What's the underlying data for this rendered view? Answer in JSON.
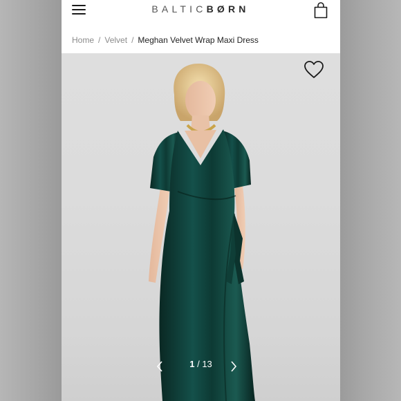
{
  "brand": {
    "name_light": "BALTIC",
    "name_bold": "BØRN"
  },
  "breadcrumb": {
    "items": [
      "Home",
      "Velvet"
    ],
    "separator": "/",
    "current": "Meghan Velvet Wrap Maxi Dress"
  },
  "gallery": {
    "current": "1",
    "separator": "/",
    "total": "13"
  },
  "icons": {
    "menu": "hamburger-menu-icon",
    "cart": "shopping-bag-icon",
    "wishlist": "heart-icon",
    "prev": "chevron-left-icon",
    "next": "chevron-right-icon"
  },
  "colors": {
    "dress": "#0f3a33",
    "background": "#dcdcdc",
    "text_dark": "#222222",
    "text_muted": "#8b8b8b"
  }
}
